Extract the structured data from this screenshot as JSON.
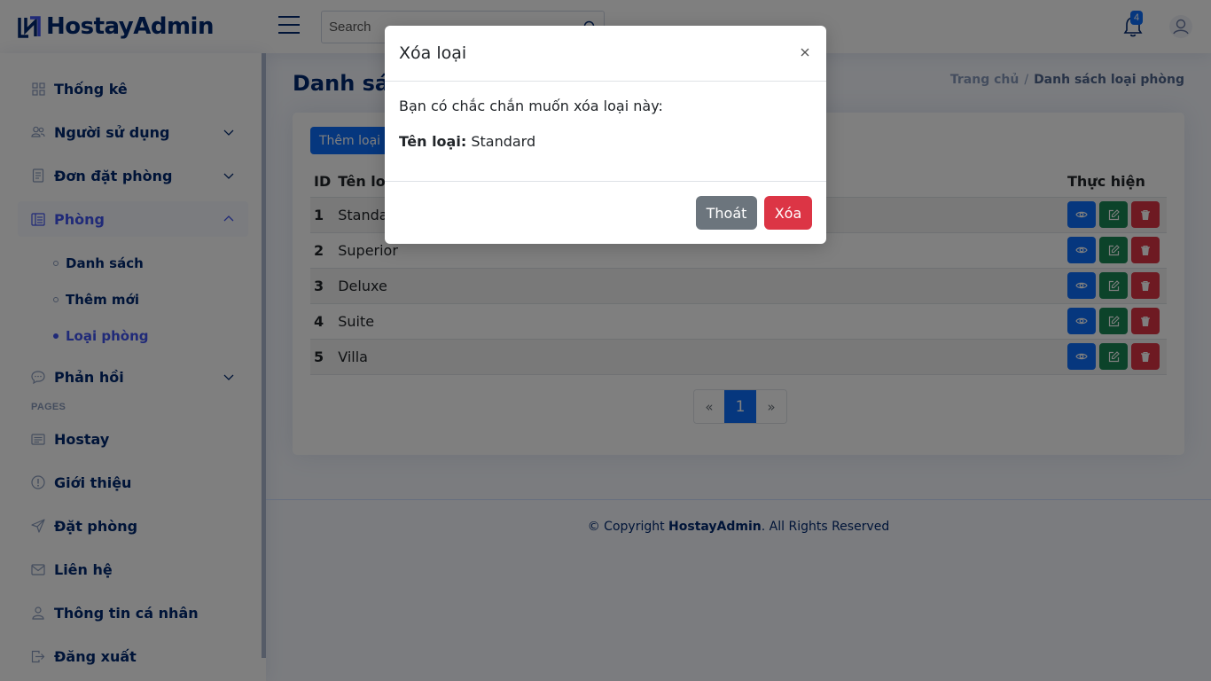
{
  "brand": {
    "name": "HostayAdmin"
  },
  "search": {
    "placeholder": "Search"
  },
  "notifications": {
    "count": "4"
  },
  "sidebar": {
    "items": [
      {
        "label": "Thống kê",
        "icon": "grid-icon"
      },
      {
        "label": "Người sử dụng",
        "icon": "people-icon"
      },
      {
        "label": "Đơn đặt phòng",
        "icon": "receipt-icon"
      },
      {
        "label": "Phòng",
        "icon": "layout-icon"
      }
    ],
    "sub_items": [
      {
        "label": "Danh sách"
      },
      {
        "label": "Thêm mới"
      },
      {
        "label": "Loại phòng"
      }
    ],
    "feedback": {
      "label": "Phản hồi",
      "icon": "chat-icon"
    },
    "heading": "PAGES",
    "pages": [
      {
        "label": "Hostay",
        "icon": "card-icon"
      },
      {
        "label": "Giới thiệu",
        "icon": "info-icon"
      },
      {
        "label": "Đặt phòng",
        "icon": "send-icon"
      },
      {
        "label": "Liên hệ",
        "icon": "envelope-icon"
      },
      {
        "label": "Thông tin cá nhân",
        "icon": "person-icon"
      },
      {
        "label": "Đăng xuất",
        "icon": "logout-icon"
      }
    ]
  },
  "main": {
    "title": "Danh sách",
    "breadcrumb": {
      "home": "Trang chủ",
      "current": "Danh sách loại phòng"
    },
    "add_button": "Thêm loại p",
    "table": {
      "headers": {
        "id": "ID",
        "name": "Tên loại",
        "actions": "Thực hiện"
      },
      "rows": [
        {
          "id": "1",
          "name": "Standard"
        },
        {
          "id": "2",
          "name": "Superior"
        },
        {
          "id": "3",
          "name": "Deluxe"
        },
        {
          "id": "4",
          "name": "Suite"
        },
        {
          "id": "5",
          "name": "Villa"
        }
      ]
    },
    "pagination": {
      "prev": "«",
      "current": "1",
      "next": "»"
    }
  },
  "footer": {
    "prefix": "© Copyright ",
    "brand": "HostayAdmin",
    "suffix": ". All Rights Reserved"
  },
  "modal": {
    "title": "Xóa loại",
    "message": "Bạn có chắc chắn muốn xóa loại này:",
    "field_label": "Tên loại:",
    "field_value": "Standard",
    "cancel_label": "Thoát",
    "delete_label": "Xóa"
  },
  "colors": {
    "primary": "#0d6efd",
    "success": "#198754",
    "danger": "#dc3545",
    "secondary": "#6c757d",
    "brand": "#012970",
    "accent": "#4154f1"
  }
}
